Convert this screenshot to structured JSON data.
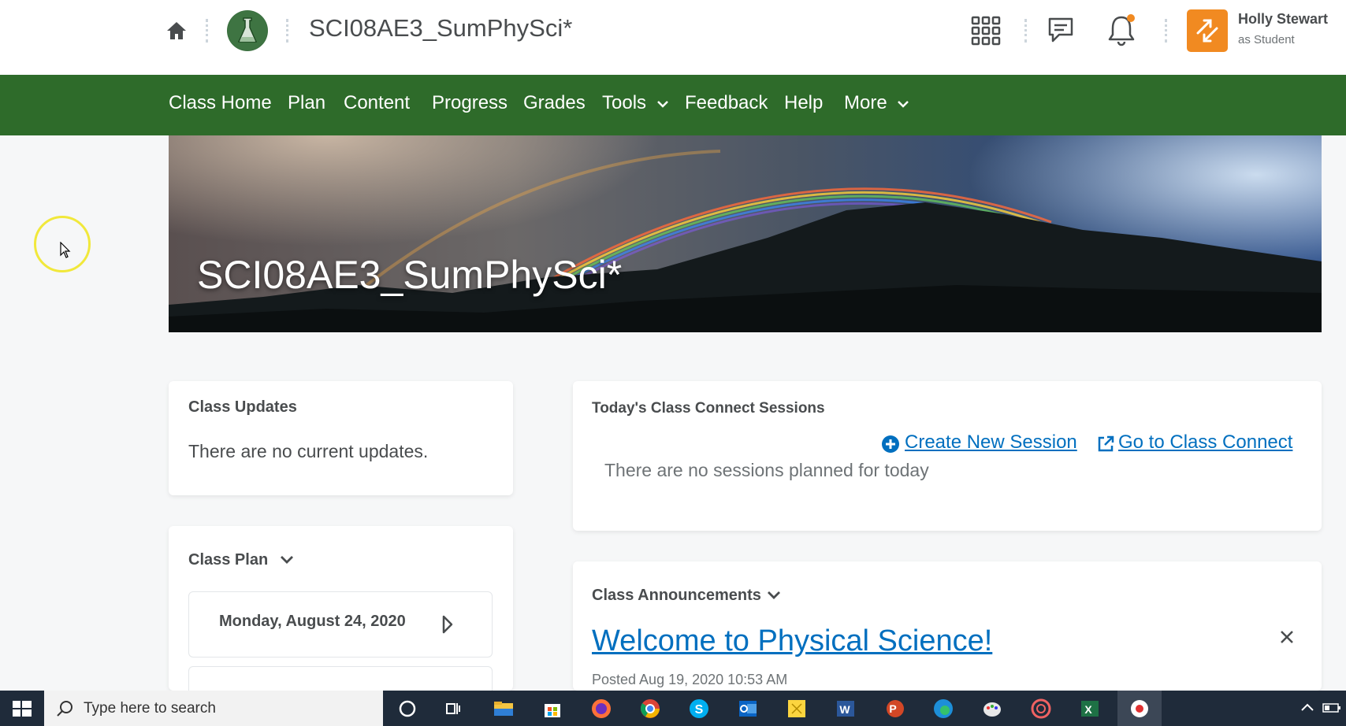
{
  "header": {
    "course_title": "SCI08AE3_SumPhySci*",
    "user_name": "Holly Stewart",
    "user_role": "as Student"
  },
  "nav": {
    "items": [
      {
        "label": "Class Home"
      },
      {
        "label": "Plan"
      },
      {
        "label": "Content"
      },
      {
        "label": "Progress"
      },
      {
        "label": "Grades"
      },
      {
        "label": "Tools",
        "dropdown": true
      },
      {
        "label": "Feedback"
      },
      {
        "label": "Help"
      },
      {
        "label": "More",
        "dropdown": true
      }
    ]
  },
  "banner": {
    "title": "SCI08AE3_SumPhySci*"
  },
  "class_updates": {
    "heading": "Class Updates",
    "message": "There are no current updates."
  },
  "class_plan": {
    "heading": "Class Plan",
    "date": "Monday, August 24, 2020"
  },
  "sessions": {
    "heading": "Today's Class Connect Sessions",
    "create_label": "Create New Session",
    "goto_label": "Go to Class Connect",
    "message": "There are no sessions planned for today"
  },
  "announcements": {
    "heading": "Class Announcements",
    "title": "Welcome to Physical Science!",
    "posted": "Posted Aug 19, 2020 10:53 AM"
  },
  "taskbar": {
    "search_placeholder": "Type here to search",
    "apps": [
      "cortana-icon",
      "task-view-icon",
      "file-explorer-icon",
      "store-icon",
      "firefox-icon",
      "chrome-icon",
      "skype-icon",
      "outlook-icon",
      "sticky-notes-icon",
      "word-icon",
      "powerpoint-icon",
      "edge-icon",
      "paint-icon",
      "app-icon",
      "excel-icon",
      "record-icon"
    ]
  },
  "colors": {
    "nav_green": "#2e6b2a",
    "link_blue": "#006fbf",
    "avatar_orange": "#f18a21"
  }
}
